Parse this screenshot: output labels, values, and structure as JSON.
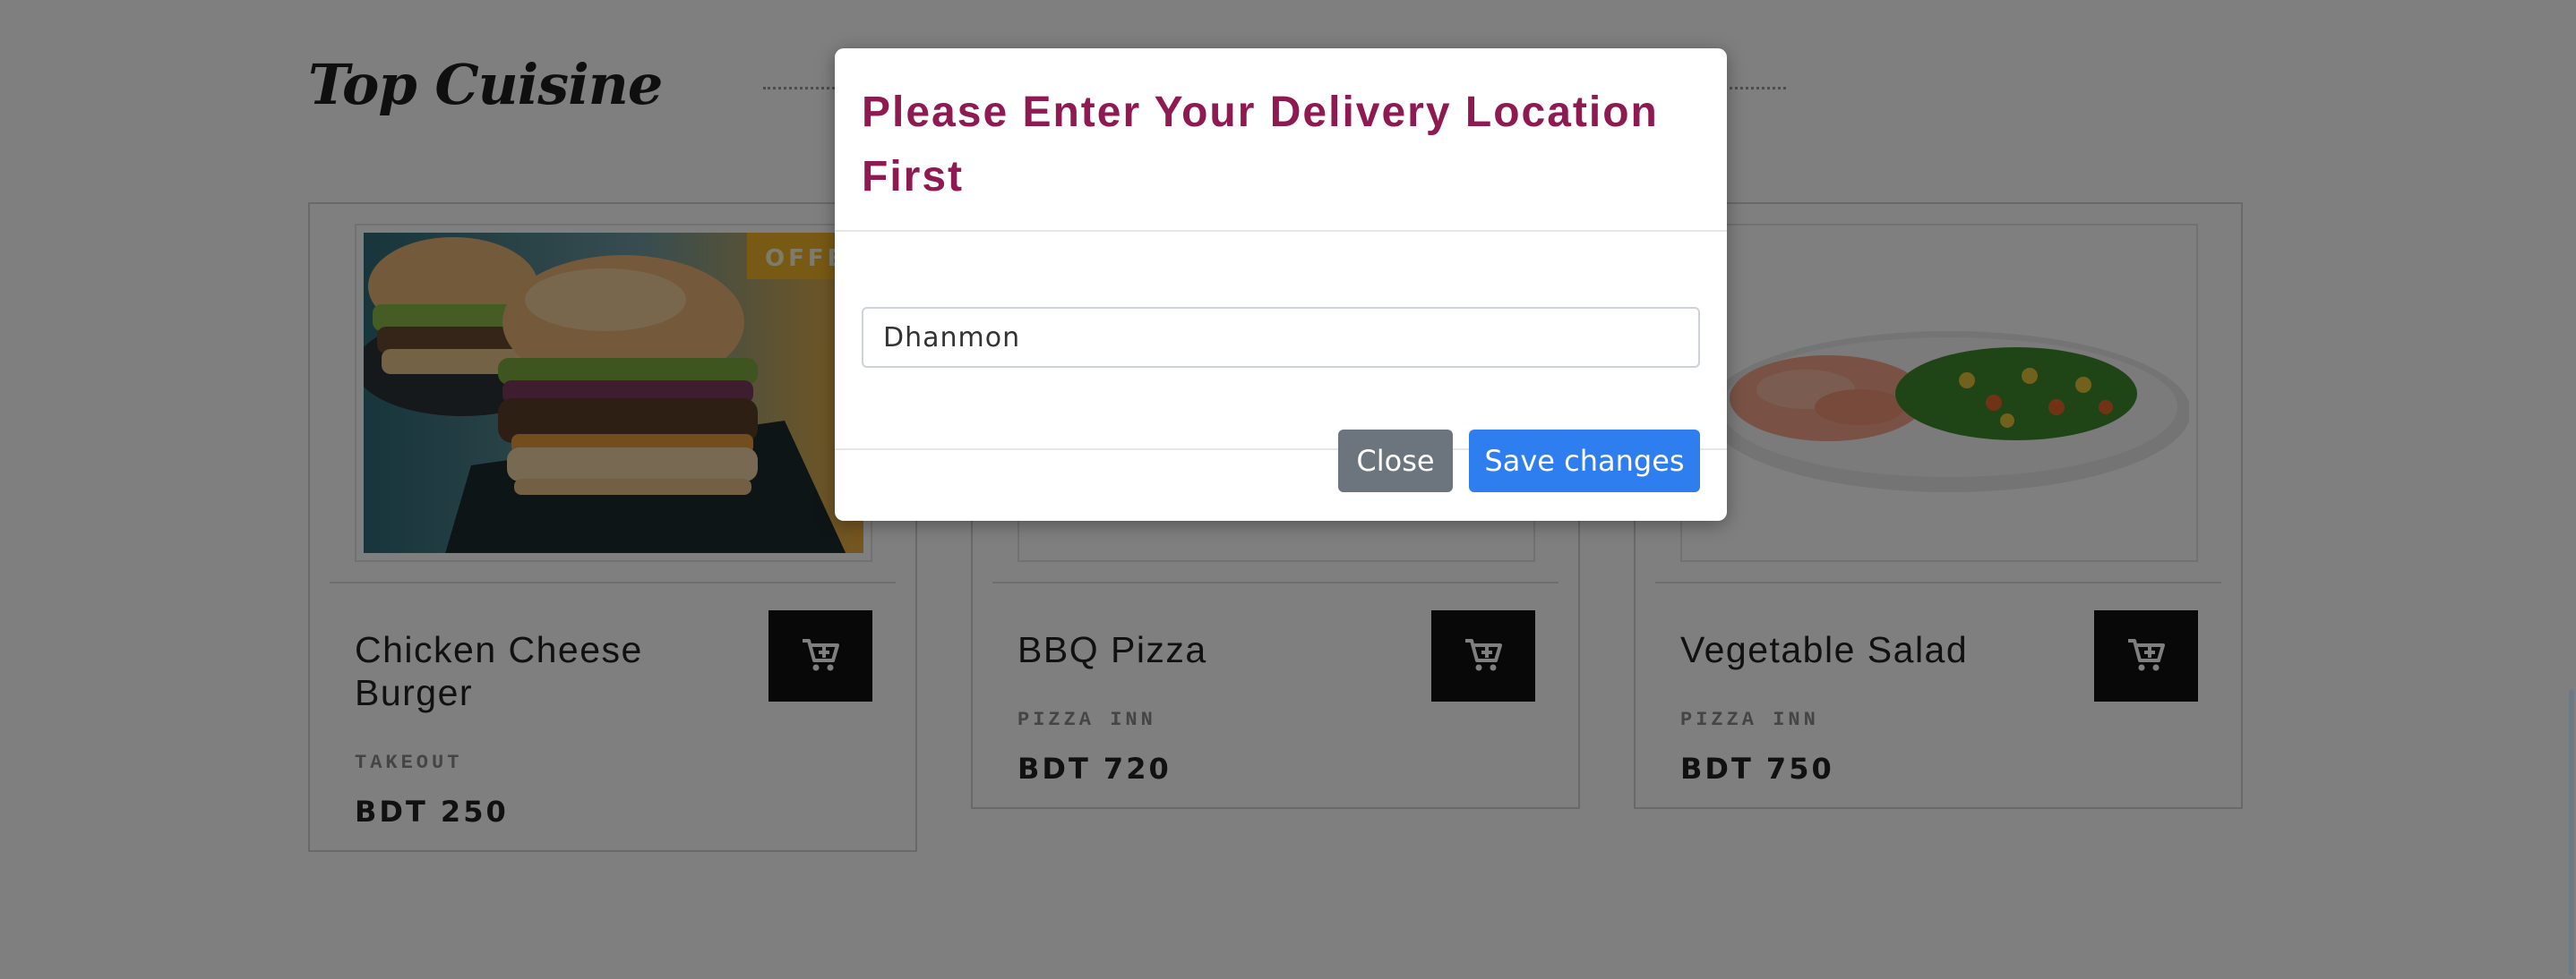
{
  "section": {
    "title": "Top Cuisine"
  },
  "cards": [
    {
      "name": "Chicken Cheese Burger",
      "vendor": "TAKEOUT",
      "price": "BDT 250",
      "badge": "OFFER",
      "image": "burger-image"
    },
    {
      "name": "BBQ Pizza",
      "vendor": "PIZZA INN",
      "price": "BDT 720",
      "image": "pizza-image"
    },
    {
      "name": "Vegetable Salad",
      "vendor": "PIZZA INN",
      "price": "BDT 750",
      "image": "salad-image"
    }
  ],
  "modal": {
    "title": "Please Enter Your Delivery Location First",
    "location_value": "Dhanmon",
    "close_label": "Close",
    "save_label": "Save changes"
  },
  "colors": {
    "title": "#8f1a52",
    "save_button": "#2f7ef0",
    "close_button": "#6c757d",
    "cart_button": "#111111"
  },
  "icons": {
    "cart": "cart-plus-icon"
  }
}
